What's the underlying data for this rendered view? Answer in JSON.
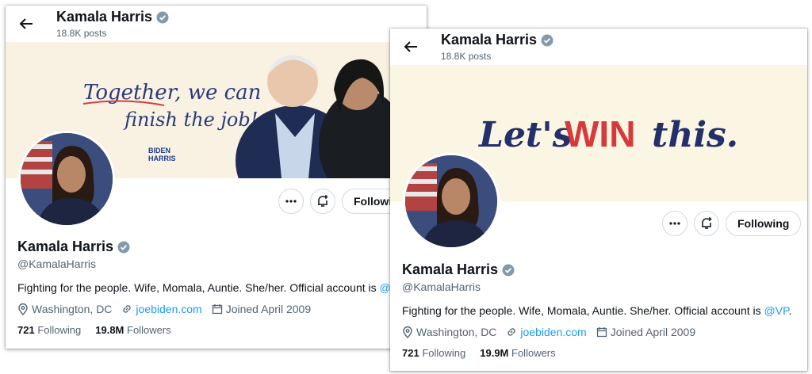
{
  "old": {
    "header": {
      "name": "Kamala Harris",
      "posts": "18.8K posts"
    },
    "banner": {
      "line1": "Together, we can",
      "line2": "finish the job!",
      "logo_top": "BIDEN",
      "logo_bottom": "HARRIS"
    },
    "follow_label": "Followin",
    "profile": {
      "name": "Kamala Harris",
      "handle": "@KamalaHarris",
      "bio": "Fighting for the people. Wife, Momala, Auntie. She/her. Official account is ",
      "bio_link": "@VP",
      "location": "Washington, DC",
      "website": "joebiden.com",
      "joined": "Joined April 2009",
      "following_count": "721",
      "following_label": "Following",
      "followers_count": "19.8M",
      "followers_label": "Followers"
    }
  },
  "new": {
    "header": {
      "name": "Kamala Harris",
      "posts": "18.8K posts"
    },
    "banner": {
      "w1": "Let's",
      "w2": "WIN",
      "w3": "this."
    },
    "follow_label": "Following",
    "profile": {
      "name": "Kamala Harris",
      "handle": "@KamalaHarris",
      "bio": "Fighting for the people. Wife, Momala, Auntie. She/her. Official account is ",
      "bio_link": "@VP",
      "bio_end": ".",
      "location": "Washington, DC",
      "website": "joebiden.com",
      "joined": "Joined April 2009",
      "following_count": "721",
      "following_label": "Following",
      "followers_count": "19.9M",
      "followers_label": "Followers"
    }
  },
  "colors": {
    "accent": "#1d9bf0",
    "win_red": "#d63a3a",
    "navy": "#23306b"
  }
}
